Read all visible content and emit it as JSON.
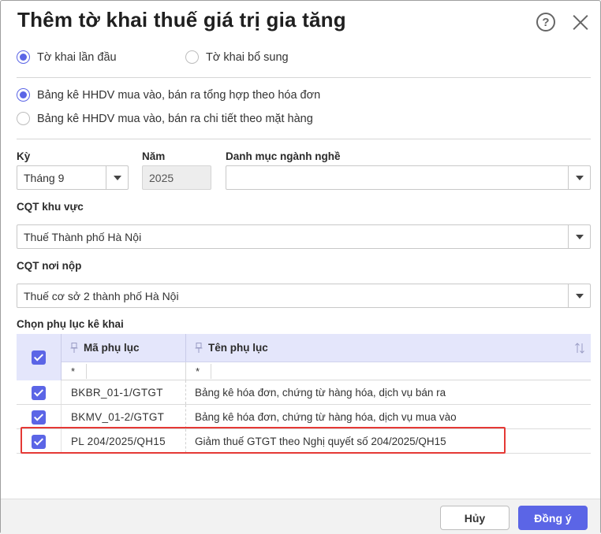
{
  "dialog": {
    "title": "Thêm tờ khai thuế giá trị gia tăng"
  },
  "declaration_type": {
    "options": [
      {
        "label": "Tờ khai lần đầu",
        "checked": true
      },
      {
        "label": "Tờ khai bổ sung",
        "checked": false
      }
    ]
  },
  "list_type": {
    "options": [
      {
        "label": "Bảng kê HHDV mua vào, bán ra tổng hợp theo hóa đơn",
        "checked": true
      },
      {
        "label": "Bảng kê HHDV mua vào, bán ra chi tiết theo mặt hàng",
        "checked": false
      }
    ]
  },
  "form": {
    "period_label": "Kỳ",
    "period_value": "Tháng 9",
    "year_label": "Năm",
    "year_value": "2025",
    "industry_label": "Danh mục ngành nghề",
    "industry_value": "",
    "tax_office_region_label": "CQT khu vực",
    "tax_office_region_value": "Thuế Thành phố Hà Nội",
    "tax_office_submit_label": "CQT nơi nộp",
    "tax_office_submit_value": "Thuế cơ sở 2 thành phố Hà Nội",
    "appendix_label": "Chọn phụ lục kê khai"
  },
  "grid": {
    "columns": [
      "Mã phụ lục",
      "Tên phụ lục"
    ],
    "filter_placeholder": "*",
    "rows": [
      {
        "code": "BKBR_01-1/GTGT",
        "name": "Bảng kê hóa đơn, chứng từ hàng hóa, dịch vụ bán ra",
        "checked": true
      },
      {
        "code": "BKMV_01-2/GTGT",
        "name": "Bảng kê hóa đơn, chứng từ hàng hóa, dịch vụ mua vào",
        "checked": true
      },
      {
        "code": "PL 204/2025/QH15",
        "name": "Giảm thuế GTGT theo Nghị quyết số 204/2025/QH15",
        "checked": true
      }
    ]
  },
  "footer": {
    "cancel_label": "Hủy",
    "ok_label": "Đồng ý"
  },
  "colors": {
    "accent": "#5b65e6",
    "header_bg": "#e4e6fb",
    "highlight": "#e53935"
  }
}
